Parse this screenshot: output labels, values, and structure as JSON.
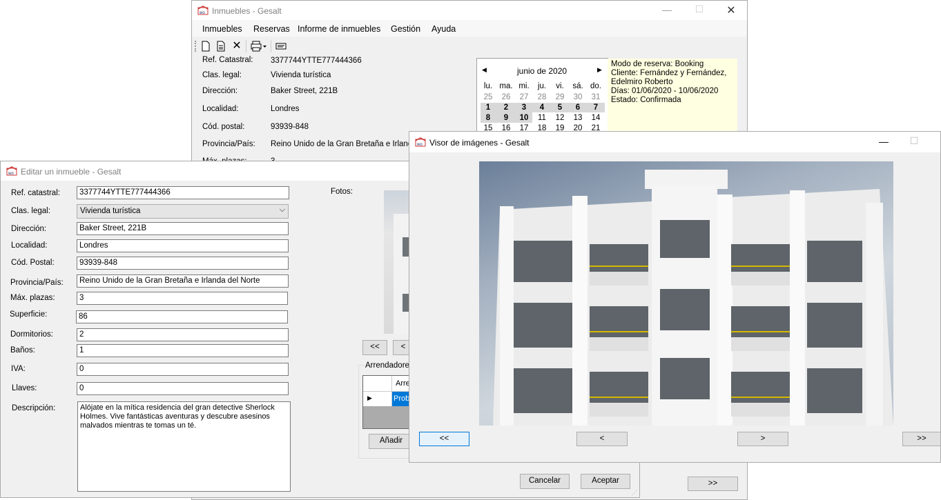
{
  "main_window": {
    "title": "Inmuebles - Gesalt",
    "menu": [
      "Inmuebles",
      "Reservas",
      "Informe de inmuebles",
      "Gestión",
      "Ayuda"
    ],
    "fields": [
      {
        "label": "Ref. Catastral:",
        "value": "3377744YTTE777444366"
      },
      {
        "label": "Clas. legal:",
        "value": "Vivienda turística"
      },
      {
        "label": "Dirección:",
        "value": "Baker Street, 221B"
      },
      {
        "label": "Localidad:",
        "value": "Londres"
      },
      {
        "label": "Cód. postal:",
        "value": "93939-848"
      },
      {
        "label": "Provincia/País:",
        "value": "Reino Unido de la Gran Bretaña e Irlanda de"
      },
      {
        "label": "Máx. plazas:",
        "value": "3"
      }
    ],
    "calendar": {
      "month": "junio de 2020",
      "weekdays": [
        "lu.",
        "ma.",
        "mi.",
        "ju.",
        "vi.",
        "sá.",
        "do."
      ],
      "rows": [
        [
          "25",
          "26",
          "27",
          "28",
          "29",
          "30",
          "31"
        ],
        [
          "1",
          "2",
          "3",
          "4",
          "5",
          "6",
          "7"
        ],
        [
          "8",
          "9",
          "10",
          "11",
          "12",
          "13",
          "14"
        ],
        [
          "15",
          "16",
          "17",
          "18",
          "19",
          "20",
          "21"
        ]
      ]
    },
    "reservation_info": {
      "line1": "Modo de reserva: Booking",
      "line2": "Cliente: Fernández y Fernández,",
      "line3": "Edelmiro Roberto",
      "line4": "Días: 01/06/2020 - 10/06/2020",
      "line5": "Estado: Confirmada"
    },
    "bottom_button": ">>"
  },
  "edit_window": {
    "title": "Editar un inmueble - Gesalt",
    "labels": {
      "ref": "Ref. catastral:",
      "clas": "Clas. legal:",
      "dir": "Dirección:",
      "loc": "Localidad:",
      "cp": "Cód. Postal:",
      "prov": "Provincia/País:",
      "max": "Máx. plazas:",
      "sup": "Superficie:",
      "dorm": "Dormitorios:",
      "banos": "Baños:",
      "iva": "IVA:",
      "llaves": "Llaves:",
      "desc": "Descripción:",
      "fotos": "Fotos:"
    },
    "values": {
      "ref": "3377744YTTE777444366",
      "clas": "Vivienda turística",
      "dir": "Baker Street, 221B",
      "loc": "Londres",
      "cp": "93939-848",
      "prov": "Reino Unido de la Gran Bretaña e Irlanda del Norte",
      "max": "3",
      "sup": "86",
      "dorm": "2",
      "banos": "1",
      "iva": "0",
      "llaves": "0",
      "desc": "Alójate en la mítica residencia del gran detective Sherlock Holmes. Vive fantásticas aventuras y descubre asesinos malvados mientras te tomas un té."
    },
    "photo_first": "<<",
    "photo_prev": "<",
    "arrendadores_label": "Arrendadores",
    "grid_header": "Arre",
    "grid_row": "Probe",
    "add_button": "Añadir",
    "cancel_button": "Cancelar",
    "accept_button": "Aceptar"
  },
  "viewer_window": {
    "title": "Visor de imágenes - Gesalt",
    "first": "<<",
    "prev": "<",
    "next": ">",
    "last": ">>"
  }
}
